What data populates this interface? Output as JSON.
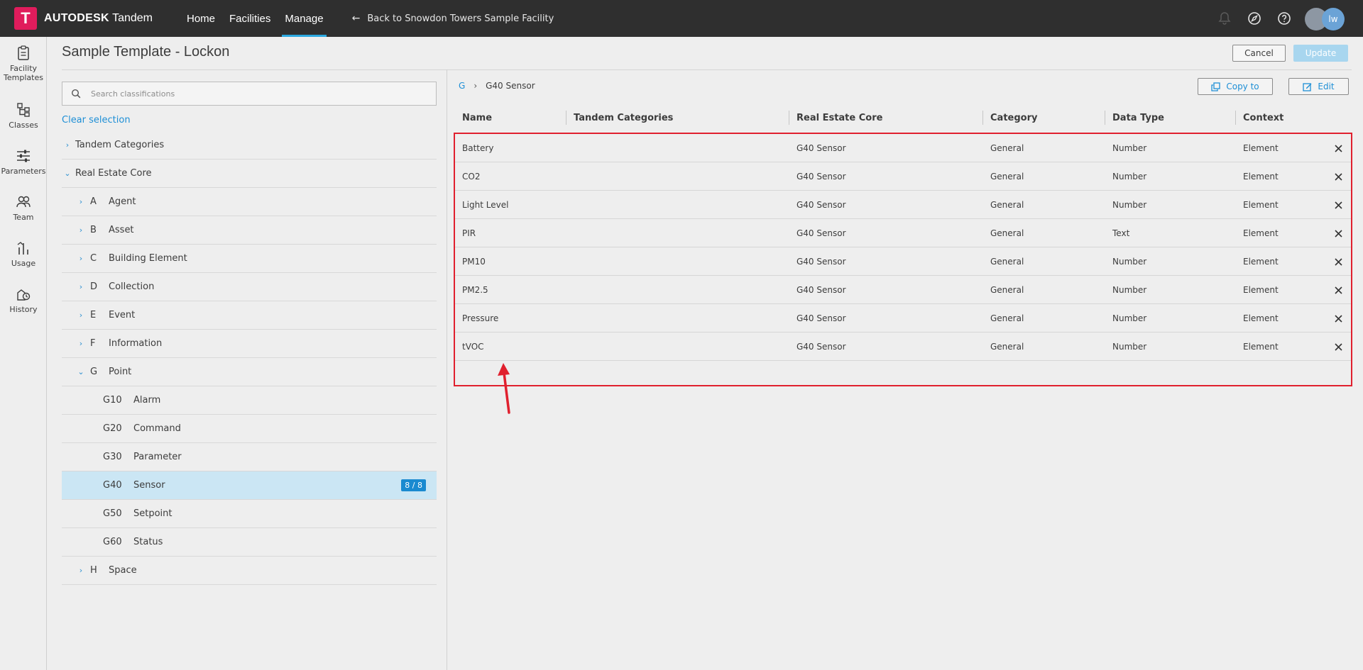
{
  "header": {
    "brand_bold": "AUTODESK",
    "brand_light": "Tandem",
    "logo_letter": "T",
    "nav": [
      {
        "label": "Home"
      },
      {
        "label": "Facilities"
      },
      {
        "label": "Manage"
      }
    ],
    "back_link": "Back to Snowdon Towers Sample Facility",
    "user_initials": "lw"
  },
  "rail": {
    "items": [
      {
        "label_line1": "Facility",
        "label_line2": "Templates"
      },
      {
        "label_line1": "Classes",
        "label_line2": ""
      },
      {
        "label_line1": "Parameters",
        "label_line2": ""
      },
      {
        "label_line1": "Team",
        "label_line2": ""
      },
      {
        "label_line1": "Usage",
        "label_line2": ""
      },
      {
        "label_line1": "History",
        "label_line2": ""
      }
    ]
  },
  "page": {
    "title": "Sample Template - Lockon",
    "cancel_label": "Cancel",
    "update_label": "Update"
  },
  "left_panel": {
    "search_placeholder": "Search classifications",
    "clear_label": "Clear selection",
    "tree": [
      {
        "code": "",
        "label": "Tandem Categories",
        "chevron": "›",
        "level": 0
      },
      {
        "code": "",
        "label": "Real Estate Core",
        "chevron": "⌄",
        "level": 0
      },
      {
        "code": "A",
        "label": "Agent",
        "chevron": "›",
        "level": 1
      },
      {
        "code": "B",
        "label": "Asset",
        "chevron": "›",
        "level": 1
      },
      {
        "code": "C",
        "label": "Building Element",
        "chevron": "›",
        "level": 1
      },
      {
        "code": "D",
        "label": "Collection",
        "chevron": "›",
        "level": 1
      },
      {
        "code": "E",
        "label": "Event",
        "chevron": "›",
        "level": 1
      },
      {
        "code": "F",
        "label": "Information",
        "chevron": "›",
        "level": 1
      },
      {
        "code": "G",
        "label": "Point",
        "chevron": "⌄",
        "level": 1
      },
      {
        "code": "G10",
        "label": "Alarm",
        "chevron": "",
        "level": 2
      },
      {
        "code": "G20",
        "label": "Command",
        "chevron": "",
        "level": 2
      },
      {
        "code": "G30",
        "label": "Parameter",
        "chevron": "",
        "level": 2
      },
      {
        "code": "G40",
        "label": "Sensor",
        "chevron": "",
        "level": 2,
        "selected": true,
        "badge": "8 / 8"
      },
      {
        "code": "G50",
        "label": "Setpoint",
        "chevron": "",
        "level": 2
      },
      {
        "code": "G60",
        "label": "Status",
        "chevron": "",
        "level": 2
      },
      {
        "code": "H",
        "label": "Space",
        "chevron": "›",
        "level": 1
      }
    ]
  },
  "right_panel": {
    "breadcrumb_root": "G",
    "breadcrumb_sep": "›",
    "breadcrumb_current": "G40 Sensor",
    "copy_label": "Copy to",
    "edit_label": "Edit",
    "columns": [
      "Name",
      "Tandem Categories",
      "Real Estate Core",
      "Category",
      "Data Type",
      "Context"
    ],
    "rows": [
      {
        "name": "Battery",
        "tandem": "",
        "rec": "G40 Sensor",
        "category": "General",
        "type": "Number",
        "context": "Element"
      },
      {
        "name": "CO2",
        "tandem": "",
        "rec": "G40 Sensor",
        "category": "General",
        "type": "Number",
        "context": "Element"
      },
      {
        "name": "Light Level",
        "tandem": "",
        "rec": "G40 Sensor",
        "category": "General",
        "type": "Number",
        "context": "Element"
      },
      {
        "name": "PIR",
        "tandem": "",
        "rec": "G40 Sensor",
        "category": "General",
        "type": "Text",
        "context": "Element"
      },
      {
        "name": "PM10",
        "tandem": "",
        "rec": "G40 Sensor",
        "category": "General",
        "type": "Number",
        "context": "Element"
      },
      {
        "name": "PM2.5",
        "tandem": "",
        "rec": "G40 Sensor",
        "category": "General",
        "type": "Number",
        "context": "Element"
      },
      {
        "name": "Pressure",
        "tandem": "",
        "rec": "G40 Sensor",
        "category": "General",
        "type": "Number",
        "context": "Element"
      },
      {
        "name": "tVOC",
        "tandem": "",
        "rec": "G40 Sensor",
        "category": "General",
        "type": "Number",
        "context": "Element"
      }
    ]
  },
  "colors": {
    "accent": "#1e8fd6",
    "brand": "#e01c5c",
    "annotation": "#e0202e",
    "selected_row": "#cbe6f4"
  }
}
